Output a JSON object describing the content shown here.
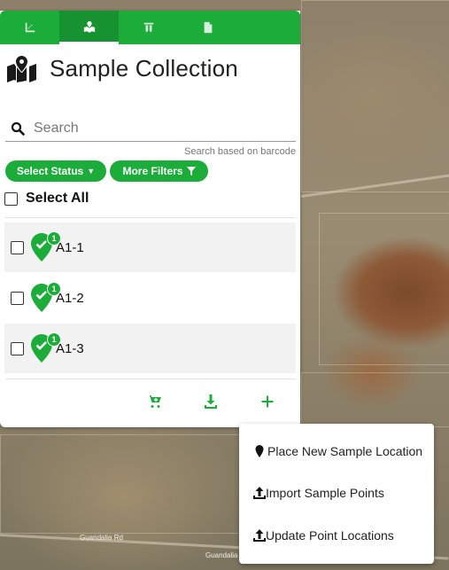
{
  "tabs": [
    {
      "icon": "ruler-icon"
    },
    {
      "icon": "map-marker-icon",
      "active": true
    },
    {
      "icon": "test-tubes-icon"
    },
    {
      "icon": "document-icon"
    }
  ],
  "header": {
    "title": "Sample Collection",
    "icon": "map-icon"
  },
  "search": {
    "placeholder": "Search",
    "hint": "Search based on barcode"
  },
  "filters": {
    "status_label": "Select Status",
    "more_label": "More Filters"
  },
  "select_all": {
    "label": "Select All"
  },
  "samples": [
    {
      "name": "A1-1",
      "count": "1"
    },
    {
      "name": "A1-2",
      "count": "1"
    },
    {
      "name": "A1-3",
      "count": "1"
    }
  ],
  "actions": [
    "cart-add-icon",
    "download-icon",
    "plus-icon"
  ],
  "menu": {
    "items": [
      {
        "label": "Place New Sample Location",
        "icon": "map-pin-icon"
      },
      {
        "label": "Import Sample Points",
        "icon": "upload-icon"
      },
      {
        "label": "Update Point Locations",
        "icon": "upload-icon"
      }
    ]
  },
  "map": {
    "road_labels": [
      "Guandalia Rd",
      "Guandalia Rd"
    ]
  },
  "colors": {
    "brand_green": "#1cac3a",
    "brand_green_dark": "#169230"
  }
}
